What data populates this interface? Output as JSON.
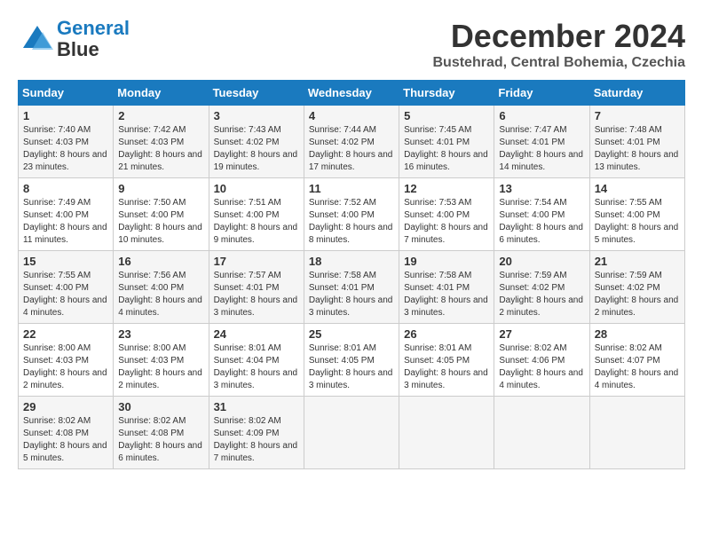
{
  "logo": {
    "line1": "General",
    "line2": "Blue"
  },
  "title": "December 2024",
  "subtitle": "Bustehrad, Central Bohemia, Czechia",
  "days_header": [
    "Sunday",
    "Monday",
    "Tuesday",
    "Wednesday",
    "Thursday",
    "Friday",
    "Saturday"
  ],
  "weeks": [
    [
      {
        "day": "1",
        "sunrise": "7:40 AM",
        "sunset": "4:03 PM",
        "daylight": "8 hours and 23 minutes."
      },
      {
        "day": "2",
        "sunrise": "7:42 AM",
        "sunset": "4:03 PM",
        "daylight": "8 hours and 21 minutes."
      },
      {
        "day": "3",
        "sunrise": "7:43 AM",
        "sunset": "4:02 PM",
        "daylight": "8 hours and 19 minutes."
      },
      {
        "day": "4",
        "sunrise": "7:44 AM",
        "sunset": "4:02 PM",
        "daylight": "8 hours and 17 minutes."
      },
      {
        "day": "5",
        "sunrise": "7:45 AM",
        "sunset": "4:01 PM",
        "daylight": "8 hours and 16 minutes."
      },
      {
        "day": "6",
        "sunrise": "7:47 AM",
        "sunset": "4:01 PM",
        "daylight": "8 hours and 14 minutes."
      },
      {
        "day": "7",
        "sunrise": "7:48 AM",
        "sunset": "4:01 PM",
        "daylight": "8 hours and 13 minutes."
      }
    ],
    [
      {
        "day": "8",
        "sunrise": "7:49 AM",
        "sunset": "4:00 PM",
        "daylight": "8 hours and 11 minutes."
      },
      {
        "day": "9",
        "sunrise": "7:50 AM",
        "sunset": "4:00 PM",
        "daylight": "8 hours and 10 minutes."
      },
      {
        "day": "10",
        "sunrise": "7:51 AM",
        "sunset": "4:00 PM",
        "daylight": "8 hours and 9 minutes."
      },
      {
        "day": "11",
        "sunrise": "7:52 AM",
        "sunset": "4:00 PM",
        "daylight": "8 hours and 8 minutes."
      },
      {
        "day": "12",
        "sunrise": "7:53 AM",
        "sunset": "4:00 PM",
        "daylight": "8 hours and 7 minutes."
      },
      {
        "day": "13",
        "sunrise": "7:54 AM",
        "sunset": "4:00 PM",
        "daylight": "8 hours and 6 minutes."
      },
      {
        "day": "14",
        "sunrise": "7:55 AM",
        "sunset": "4:00 PM",
        "daylight": "8 hours and 5 minutes."
      }
    ],
    [
      {
        "day": "15",
        "sunrise": "7:55 AM",
        "sunset": "4:00 PM",
        "daylight": "8 hours and 4 minutes."
      },
      {
        "day": "16",
        "sunrise": "7:56 AM",
        "sunset": "4:00 PM",
        "daylight": "8 hours and 4 minutes."
      },
      {
        "day": "17",
        "sunrise": "7:57 AM",
        "sunset": "4:01 PM",
        "daylight": "8 hours and 3 minutes."
      },
      {
        "day": "18",
        "sunrise": "7:58 AM",
        "sunset": "4:01 PM",
        "daylight": "8 hours and 3 minutes."
      },
      {
        "day": "19",
        "sunrise": "7:58 AM",
        "sunset": "4:01 PM",
        "daylight": "8 hours and 3 minutes."
      },
      {
        "day": "20",
        "sunrise": "7:59 AM",
        "sunset": "4:02 PM",
        "daylight": "8 hours and 2 minutes."
      },
      {
        "day": "21",
        "sunrise": "7:59 AM",
        "sunset": "4:02 PM",
        "daylight": "8 hours and 2 minutes."
      }
    ],
    [
      {
        "day": "22",
        "sunrise": "8:00 AM",
        "sunset": "4:03 PM",
        "daylight": "8 hours and 2 minutes."
      },
      {
        "day": "23",
        "sunrise": "8:00 AM",
        "sunset": "4:03 PM",
        "daylight": "8 hours and 2 minutes."
      },
      {
        "day": "24",
        "sunrise": "8:01 AM",
        "sunset": "4:04 PM",
        "daylight": "8 hours and 3 minutes."
      },
      {
        "day": "25",
        "sunrise": "8:01 AM",
        "sunset": "4:05 PM",
        "daylight": "8 hours and 3 minutes."
      },
      {
        "day": "26",
        "sunrise": "8:01 AM",
        "sunset": "4:05 PM",
        "daylight": "8 hours and 3 minutes."
      },
      {
        "day": "27",
        "sunrise": "8:02 AM",
        "sunset": "4:06 PM",
        "daylight": "8 hours and 4 minutes."
      },
      {
        "day": "28",
        "sunrise": "8:02 AM",
        "sunset": "4:07 PM",
        "daylight": "8 hours and 4 minutes."
      }
    ],
    [
      {
        "day": "29",
        "sunrise": "8:02 AM",
        "sunset": "4:08 PM",
        "daylight": "8 hours and 5 minutes."
      },
      {
        "day": "30",
        "sunrise": "8:02 AM",
        "sunset": "4:08 PM",
        "daylight": "8 hours and 6 minutes."
      },
      {
        "day": "31",
        "sunrise": "8:02 AM",
        "sunset": "4:09 PM",
        "daylight": "8 hours and 7 minutes."
      },
      null,
      null,
      null,
      null
    ]
  ]
}
